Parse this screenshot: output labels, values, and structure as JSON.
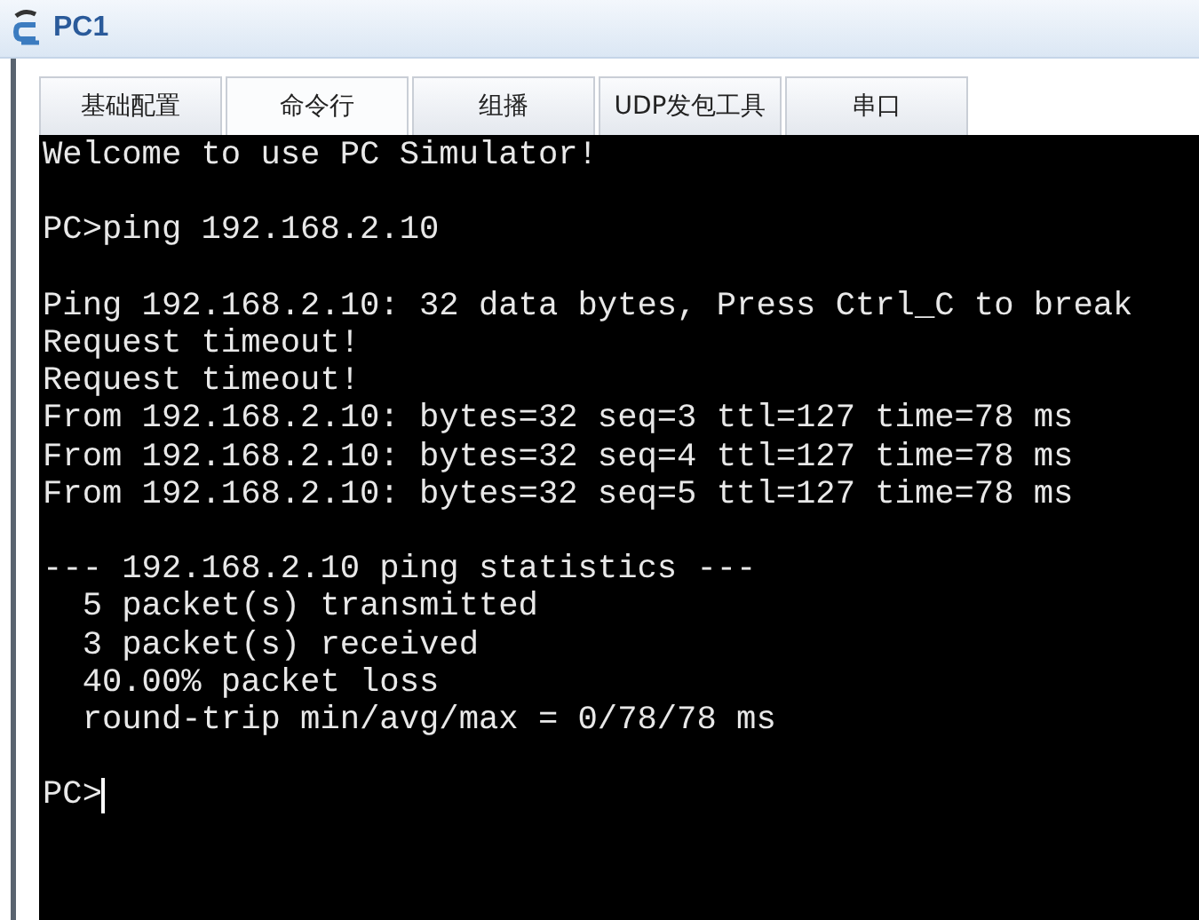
{
  "window": {
    "title": "PC1"
  },
  "tabs": [
    {
      "label": "基础配置",
      "selected": false
    },
    {
      "label": "命令行",
      "selected": true
    },
    {
      "label": "组播",
      "selected": false
    },
    {
      "label": "UDP发包工具",
      "selected": false
    },
    {
      "label": "串口",
      "selected": false
    }
  ],
  "terminal": {
    "blocks": [
      [
        "Welcome to use PC Simulator!"
      ],
      [
        "PC>ping 192.168.2.10"
      ],
      [
        "Ping 192.168.2.10: 32 data bytes, Press Ctrl_C to break",
        "Request timeout!",
        "Request timeout!",
        "From 192.168.2.10: bytes=32 seq=3 ttl=127 time=78 ms",
        "From 192.168.2.10: bytes=32 seq=4 ttl=127 time=78 ms",
        "From 192.168.2.10: bytes=32 seq=5 ttl=127 time=78 ms"
      ],
      [
        "--- 192.168.2.10 ping statistics ---",
        "  5 packet(s) transmitted",
        "  3 packet(s) received",
        "  40.00% packet loss",
        "  round-trip min/avg/max = 0/78/78 ms"
      ]
    ],
    "prompt": "PC>",
    "cursor": true
  }
}
